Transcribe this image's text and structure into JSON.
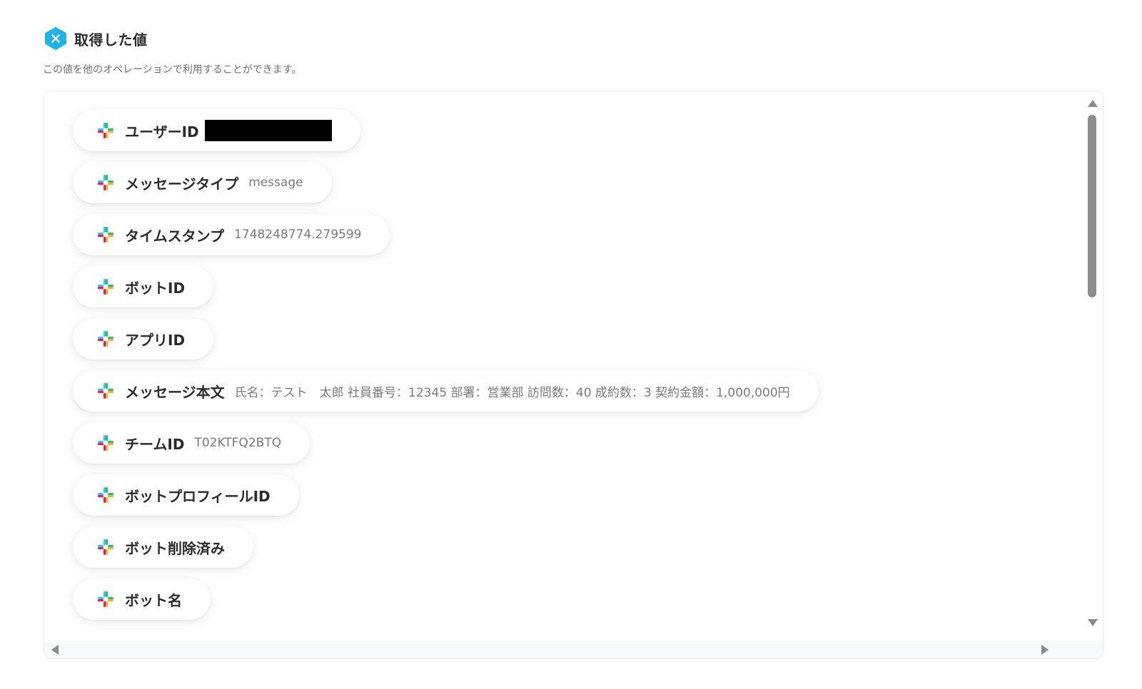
{
  "header": {
    "title": "取得した値",
    "badge_icon": "x-hexagon-icon",
    "badge_color": "#1fb3e6",
    "subtitle": "この値を他のオペレーションで利用することができます。"
  },
  "items": [
    {
      "label": "ユーザーID",
      "value": "",
      "redacted": true,
      "icon": "slack-icon"
    },
    {
      "label": "メッセージタイプ",
      "value": "message",
      "icon": "slack-icon"
    },
    {
      "label": "タイムスタンプ",
      "value": "1748248774.279599",
      "icon": "slack-icon"
    },
    {
      "label": "ボットID",
      "value": "",
      "icon": "slack-icon"
    },
    {
      "label": "アプリID",
      "value": "",
      "icon": "slack-icon"
    },
    {
      "label": "メッセージ本文",
      "value": "氏名：テスト　太郎 社員番号：12345 部署：営業部 訪問数：40 成約数：3 契約金額：1,000,000円",
      "icon": "slack-icon"
    },
    {
      "label": "チームID",
      "value": "T02KTFQ2BTQ",
      "icon": "slack-icon"
    },
    {
      "label": "ボットプロフィールID",
      "value": "",
      "icon": "slack-icon"
    },
    {
      "label": "ボット削除済み",
      "value": "",
      "icon": "slack-icon"
    },
    {
      "label": "ボット名",
      "value": "",
      "icon": "slack-icon"
    }
  ],
  "colors": {
    "slack_blue": "#36c5f0",
    "slack_green": "#2eb67d",
    "slack_yellow": "#ecb22e",
    "slack_red": "#e01e5a"
  }
}
